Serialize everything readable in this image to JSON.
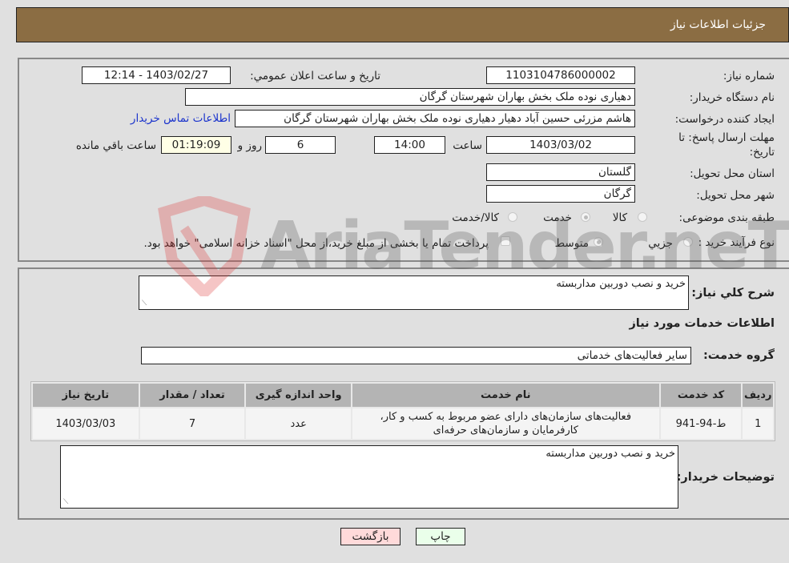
{
  "header": {
    "title": "جزئیات اطلاعات نیاز"
  },
  "details": {
    "need_number": {
      "label": "شماره نیاز:",
      "value": "1103104786000002"
    },
    "announce_datetime": {
      "label": "تاریخ و ساعت اعلان عمومي:",
      "value": "1403/02/27 - 12:14"
    },
    "buyer_org": {
      "label": "نام دستگاه خريدار:",
      "value": "دهیاری نوده ملک بخش بهاران شهرستان گرگان"
    },
    "requester": {
      "label": "ايجاد کننده درخواست:",
      "value": "هاشم مزرئی حسین آباد دهیار دهیاری نوده ملک بخش بهاران شهرستان گرگان"
    },
    "buyer_contact_link": "اطلاعات تماس خريدار",
    "deadline": {
      "label_line1": "مهلت ارسال پاسخ: تا",
      "label_line2": "تاريخ:",
      "date": "1403/03/02",
      "time_label": "ساعت",
      "time": "14:00",
      "days": "6",
      "days_label": "روز و",
      "remaining": "01:19:09",
      "remaining_label": "ساعت باقي مانده"
    },
    "province": {
      "label": "استان محل تحويل:",
      "value": "گلستان"
    },
    "city": {
      "label": "شهر محل تحويل:",
      "value": "گرگان"
    },
    "category": {
      "label": "طبقه بندی موضوعی:",
      "options": [
        "کالا",
        "خدمت",
        "کالا/خدمت"
      ],
      "selected": "خدمت"
    },
    "process": {
      "label": "نوع فرآیند خرید :",
      "options": [
        "جزيي",
        "متوسط"
      ],
      "selected": "متوسط",
      "treasury_checkbox_label": "پرداخت تمام يا بخشی از مبلغ خريد،از محل \"اسناد خزانه اسلامی\" خواهد بود.",
      "treasury_checked": false
    }
  },
  "summary": {
    "label": "شرح کلي نياز:",
    "value": "خريد و نصب دوربين مداربسته",
    "services_heading": "اطلاعات خدمات مورد نياز",
    "service_group_label": "گروه خدمت:",
    "service_group_value": "ساير فعاليت‌هاى خدماتى"
  },
  "table": {
    "headers": [
      "رديف",
      "کد خدمت",
      "نام خدمت",
      "واحد اندازه گيری",
      "تعداد / مقدار",
      "تاريخ نياز"
    ],
    "rows": [
      {
        "index": "1",
        "code": "ط-94-941",
        "name_line1": "فعاليت‌هاى سازمان‌هاى داراى عضو مربوط به کسب و کار،",
        "name_line2": "کارفرمايان و سازمان‌هاى حرفه‌اى",
        "unit": "عدد",
        "quantity": "7",
        "date": "1403/03/03"
      }
    ]
  },
  "buyer_notes": {
    "label": "توضيحات خريدار:",
    "value": "خريد و نصب دوربين مداربسته"
  },
  "buttons": {
    "print": "چاپ",
    "back": "بازگشت"
  },
  "watermark": {
    "text": "AriaTender.neT"
  },
  "colors": {
    "header_bg": "#8b6d43",
    "link": "#1a33cc",
    "print_bg": "#eaffea",
    "back_bg": "#ffdada",
    "remaining_bg": "#ffffe6"
  }
}
